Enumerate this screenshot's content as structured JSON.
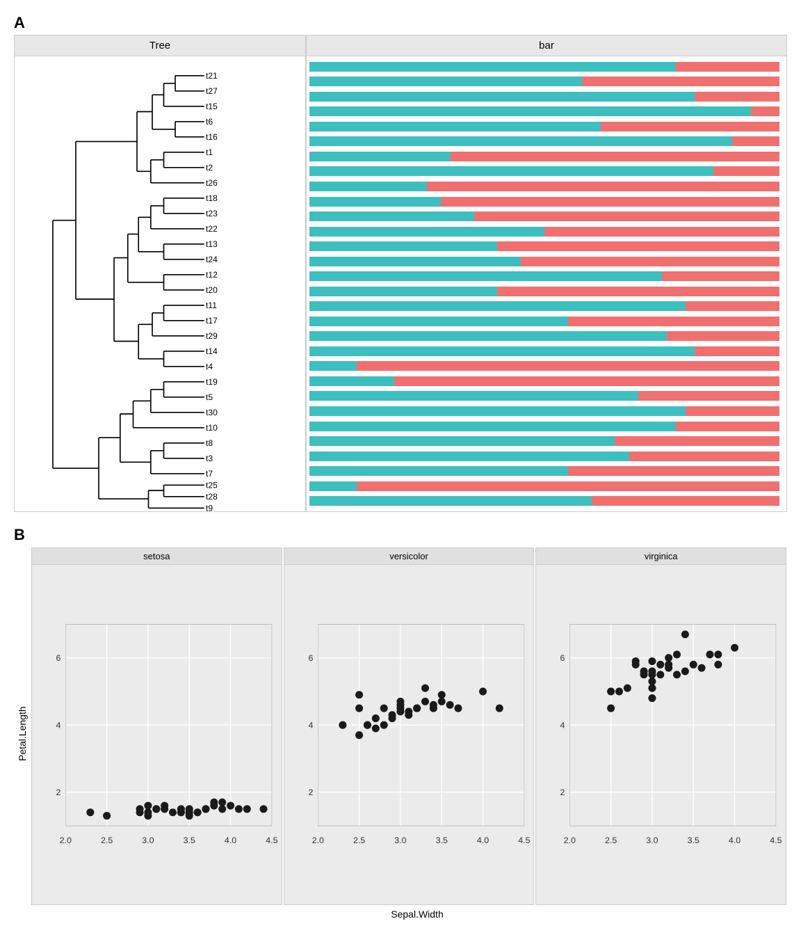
{
  "panelA": {
    "label": "A",
    "treeHeader": "Tree",
    "barHeader": "bar",
    "treeNodes": [
      "t21",
      "t27",
      "t15",
      "t6",
      "t16",
      "t1",
      "t2",
      "t26",
      "t18",
      "t23",
      "t22",
      "t13",
      "t24",
      "t12",
      "t20",
      "t11",
      "t17",
      "t29",
      "t14",
      "t4",
      "t19",
      "t5",
      "t30",
      "t10",
      "t8",
      "t3",
      "t7",
      "t25",
      "t28",
      "t9"
    ],
    "bars": [
      {
        "teal": 78,
        "salmon": 22
      },
      {
        "teal": 58,
        "salmon": 42
      },
      {
        "teal": 82,
        "salmon": 18
      },
      {
        "teal": 94,
        "salmon": 6
      },
      {
        "teal": 62,
        "salmon": 38
      },
      {
        "teal": 90,
        "salmon": 10
      },
      {
        "teal": 30,
        "salmon": 70
      },
      {
        "teal": 86,
        "salmon": 14
      },
      {
        "teal": 25,
        "salmon": 75
      },
      {
        "teal": 28,
        "salmon": 72
      },
      {
        "teal": 35,
        "salmon": 65
      },
      {
        "teal": 50,
        "salmon": 50
      },
      {
        "teal": 40,
        "salmon": 60
      },
      {
        "teal": 45,
        "salmon": 55
      },
      {
        "teal": 75,
        "salmon": 25
      },
      {
        "teal": 40,
        "salmon": 60
      },
      {
        "teal": 80,
        "salmon": 20
      },
      {
        "teal": 55,
        "salmon": 45
      },
      {
        "teal": 76,
        "salmon": 24
      },
      {
        "teal": 82,
        "salmon": 18
      },
      {
        "teal": 10,
        "salmon": 90
      },
      {
        "teal": 18,
        "salmon": 82
      },
      {
        "teal": 70,
        "salmon": 30
      },
      {
        "teal": 80,
        "salmon": 20
      },
      {
        "teal": 78,
        "salmon": 22
      },
      {
        "teal": 65,
        "salmon": 35
      },
      {
        "teal": 68,
        "salmon": 32
      },
      {
        "teal": 55,
        "salmon": 45
      },
      {
        "teal": 10,
        "salmon": 90
      },
      {
        "teal": 60,
        "salmon": 40
      }
    ]
  },
  "panelB": {
    "label": "B",
    "panels": [
      "setosa",
      "versicolor",
      "virginica"
    ],
    "xLabel": "Sepal.Width",
    "yLabel": "Petal.Length",
    "yAxisTicks": [
      "2",
      "4",
      "6"
    ],
    "xAxisTicks": [
      "2.0",
      "2.5",
      "3.0",
      "3.5",
      "4.0",
      "4.5"
    ],
    "setosaPoints": [
      [
        2.3,
        1.4
      ],
      [
        2.9,
        1.5
      ],
      [
        3.0,
        1.4
      ],
      [
        3.1,
        1.5
      ],
      [
        3.1,
        1.5
      ],
      [
        3.2,
        1.6
      ],
      [
        3.4,
        1.5
      ],
      [
        3.5,
        1.4
      ],
      [
        3.5,
        1.5
      ],
      [
        3.6,
        1.4
      ],
      [
        3.7,
        1.5
      ],
      [
        3.8,
        1.6
      ],
      [
        3.9,
        1.7
      ],
      [
        4.0,
        1.6
      ],
      [
        4.2,
        1.5
      ],
      [
        4.4,
        1.5
      ],
      [
        2.5,
        1.3
      ],
      [
        3.0,
        1.3
      ],
      [
        3.2,
        1.5
      ],
      [
        3.3,
        1.4
      ],
      [
        3.4,
        1.4
      ],
      [
        3.5,
        1.3
      ],
      [
        3.6,
        1.4
      ],
      [
        3.7,
        1.5
      ],
      [
        3.8,
        1.7
      ],
      [
        3.9,
        1.5
      ],
      [
        4.1,
        1.5
      ],
      [
        3.0,
        1.6
      ],
      [
        3.4,
        1.4
      ],
      [
        2.9,
        1.4
      ]
    ],
    "versicolorPoints": [
      [
        2.3,
        4.0
      ],
      [
        2.5,
        3.7
      ],
      [
        2.5,
        4.5
      ],
      [
        2.5,
        4.9
      ],
      [
        2.6,
        4.0
      ],
      [
        2.6,
        4.0
      ],
      [
        2.7,
        3.9
      ],
      [
        2.7,
        4.2
      ],
      [
        2.8,
        4.0
      ],
      [
        2.8,
        4.5
      ],
      [
        2.9,
        4.2
      ],
      [
        2.9,
        4.3
      ],
      [
        3.0,
        4.5
      ],
      [
        3.0,
        4.6
      ],
      [
        3.0,
        4.7
      ],
      [
        3.0,
        4.4
      ],
      [
        3.1,
        4.3
      ],
      [
        3.1,
        4.4
      ],
      [
        3.2,
        4.5
      ],
      [
        3.2,
        4.5
      ],
      [
        3.3,
        4.7
      ],
      [
        3.3,
        5.1
      ],
      [
        3.4,
        4.5
      ],
      [
        3.4,
        4.6
      ],
      [
        3.5,
        4.7
      ],
      [
        3.5,
        4.9
      ],
      [
        3.6,
        4.6
      ],
      [
        3.7,
        4.5
      ],
      [
        4.0,
        5.0
      ],
      [
        4.2,
        4.5
      ]
    ],
    "virginicaPoints": [
      [
        2.5,
        5.0
      ],
      [
        2.6,
        5.0
      ],
      [
        2.7,
        5.1
      ],
      [
        2.8,
        5.9
      ],
      [
        2.8,
        5.8
      ],
      [
        2.9,
        5.5
      ],
      [
        2.9,
        5.6
      ],
      [
        3.0,
        4.8
      ],
      [
        3.0,
        5.1
      ],
      [
        3.0,
        5.3
      ],
      [
        3.0,
        5.1
      ],
      [
        3.0,
        5.5
      ],
      [
        3.0,
        5.6
      ],
      [
        3.1,
        5.5
      ],
      [
        3.1,
        5.8
      ],
      [
        3.2,
        5.7
      ],
      [
        3.2,
        5.8
      ],
      [
        3.2,
        6.0
      ],
      [
        3.3,
        5.5
      ],
      [
        3.3,
        6.1
      ],
      [
        3.4,
        5.6
      ],
      [
        3.4,
        6.7
      ],
      [
        3.5,
        5.8
      ],
      [
        3.6,
        5.7
      ],
      [
        3.7,
        6.1
      ],
      [
        3.8,
        6.1
      ],
      [
        3.8,
        5.8
      ],
      [
        4.0,
        6.3
      ],
      [
        2.5,
        4.5
      ],
      [
        3.0,
        5.9
      ]
    ]
  }
}
